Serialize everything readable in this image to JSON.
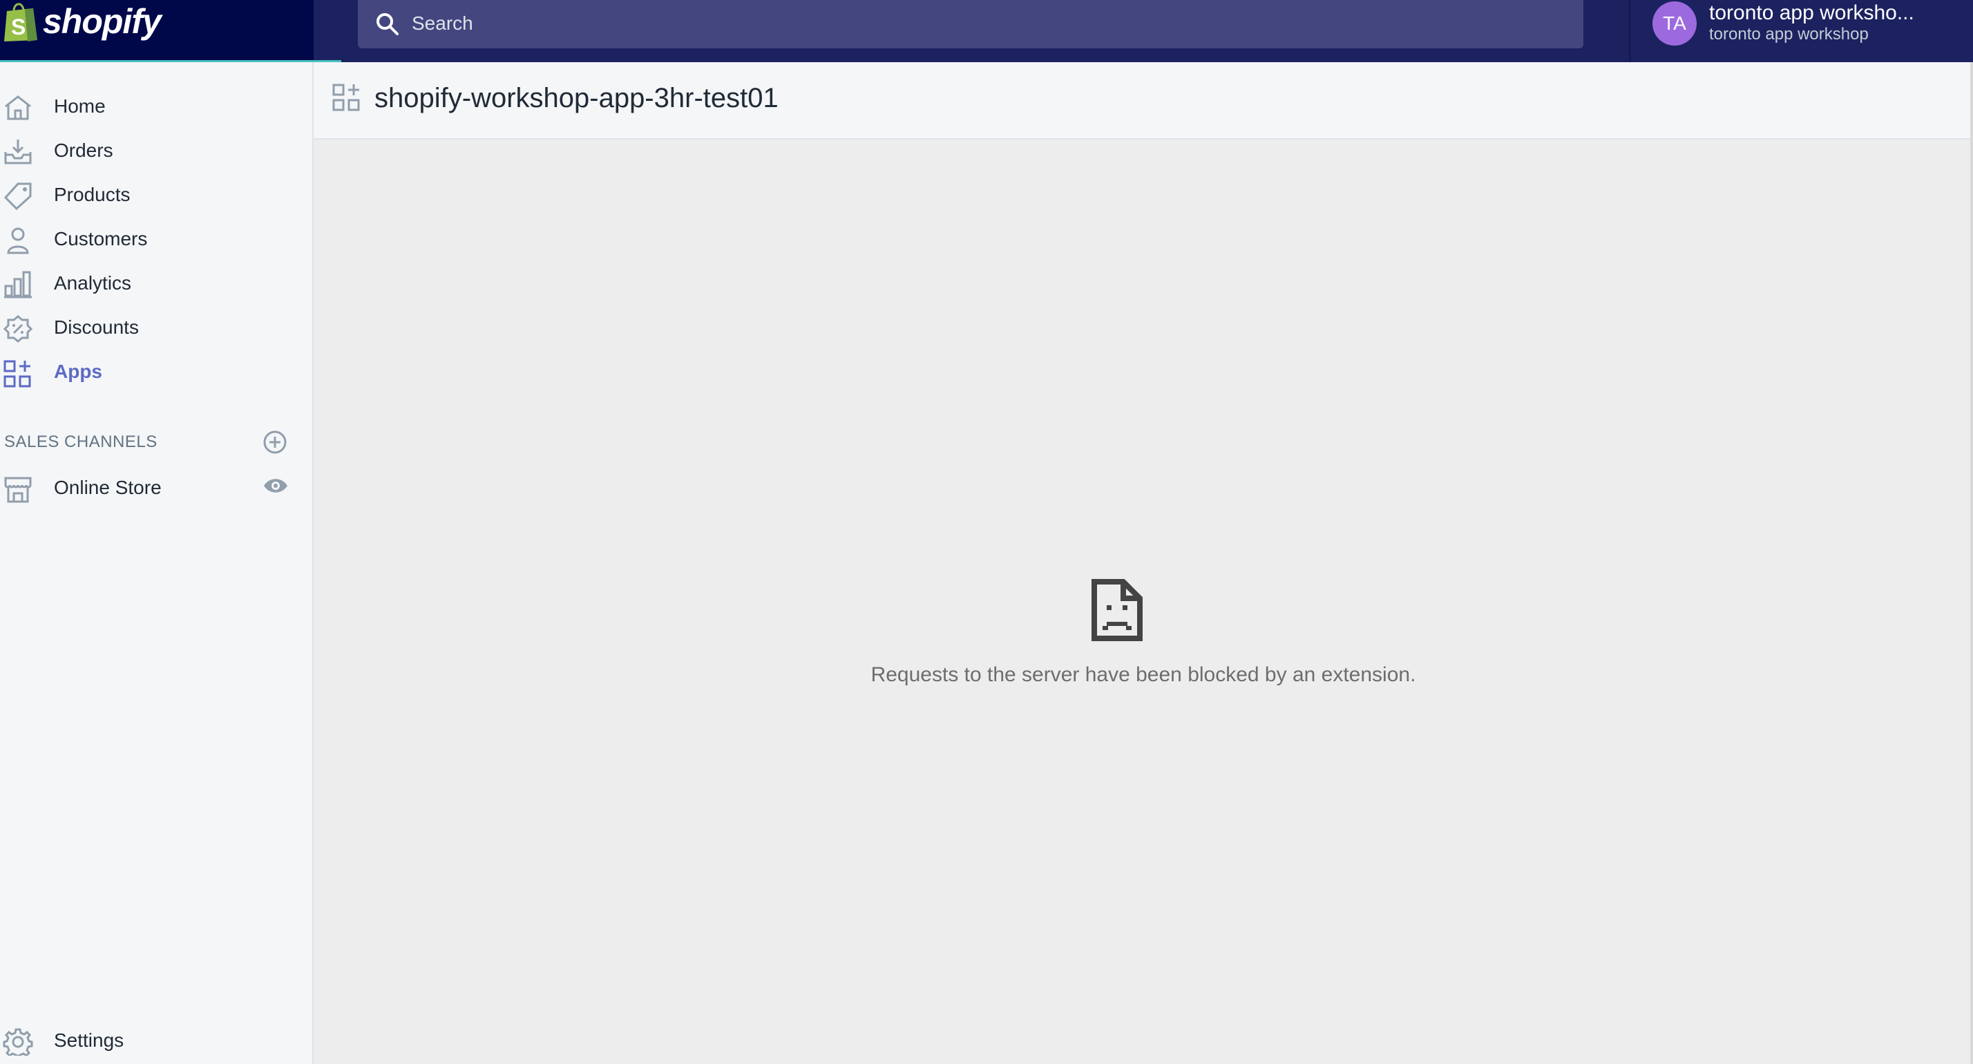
{
  "brand": {
    "name": "shopify"
  },
  "search": {
    "placeholder": "Search"
  },
  "account": {
    "initials": "TA",
    "name": "toronto app worksho...",
    "store": "toronto app workshop",
    "avatar_color": "#9c6ade"
  },
  "sidebar": {
    "items": [
      {
        "label": "Home",
        "icon": "home-icon"
      },
      {
        "label": "Orders",
        "icon": "orders-icon"
      },
      {
        "label": "Products",
        "icon": "tag-icon"
      },
      {
        "label": "Customers",
        "icon": "person-icon"
      },
      {
        "label": "Analytics",
        "icon": "bar-chart-icon"
      },
      {
        "label": "Discounts",
        "icon": "discount-icon"
      },
      {
        "label": "Apps",
        "icon": "apps-icon",
        "active": true
      }
    ],
    "sales_channels": {
      "title": "SALES CHANNELS",
      "items": [
        {
          "label": "Online Store",
          "icon": "store-icon"
        }
      ]
    },
    "settings": {
      "label": "Settings",
      "icon": "gear-icon"
    }
  },
  "main": {
    "title": "shopify-workshop-app-3hr-test01",
    "error": "Requests to the server have been blocked by an extension."
  },
  "colors": {
    "topbar": "#1c2260",
    "logo_bg": "#00084a",
    "accent": "#5c6ac4",
    "progress": "#47c1bf"
  }
}
